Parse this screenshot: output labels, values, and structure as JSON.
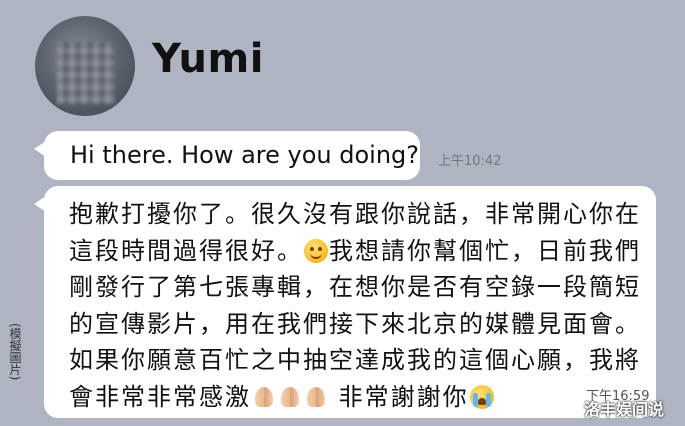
{
  "contact": {
    "name": "Yumi",
    "avatar_icon": "blurred-avatar-photo"
  },
  "messages": [
    {
      "lines": [
        "Hi there. How are you doing?"
      ],
      "time": "上午10:42"
    },
    {
      "lines": [
        "抱歉打擾你了。很久沒有跟你說話，非常開心你在",
        "這段時間過得很好。",
        "我想請你幫個忙，日前我們",
        "剛發行了第七張專輯，在想你是否有空錄一段簡短",
        "的宣傳影片，用在我們接下來北京的媒體見面會。",
        "如果你願意百忙之中抽空達成我的這個心願，我將",
        "會非常非常感激",
        "非常謝謝你"
      ],
      "time": "下午16:59",
      "emojis": [
        "smiling-face-emoji",
        "folded-hands-emoji",
        "folded-hands-emoji",
        "folded-hands-emoji",
        "crying-face-emoji"
      ]
    }
  ],
  "side_note": "(模擬圖片)",
  "watermark": "洛丰娱间说",
  "colors": {
    "background": "#aeb4c2",
    "bubble": "#ffffff",
    "text": "#111111",
    "timestamp": "#777777"
  }
}
